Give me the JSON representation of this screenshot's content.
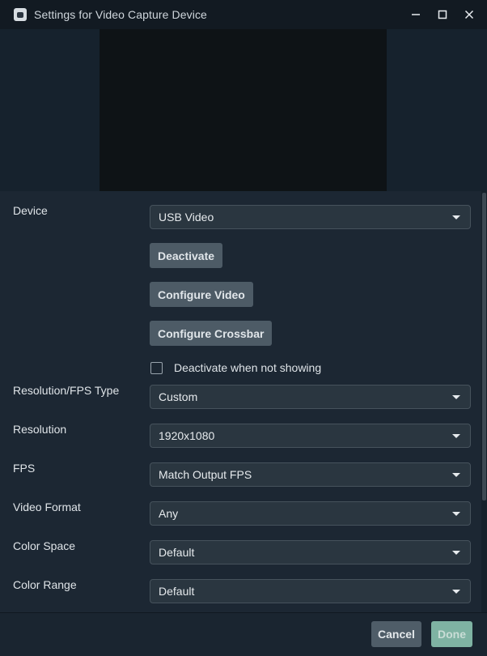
{
  "window": {
    "title": "Settings for Video Capture Device",
    "app_icon": "app-icon",
    "controls": [
      "minimize-icon",
      "maximize-icon",
      "close-icon"
    ]
  },
  "form": {
    "device": {
      "label": "Device",
      "value": "USB Video"
    },
    "buttons": {
      "deactivate": "Deactivate",
      "configure_video": "Configure Video",
      "configure_crossbar": "Configure Crossbar"
    },
    "deactivate_when_not_showing": {
      "label": "Deactivate when not showing",
      "checked": false
    },
    "resolution_fps_type": {
      "label": "Resolution/FPS Type",
      "value": "Custom"
    },
    "resolution": {
      "label": "Resolution",
      "value": "1920x1080"
    },
    "fps": {
      "label": "FPS",
      "value": "Match Output FPS"
    },
    "video_format": {
      "label": "Video Format",
      "value": "Any"
    },
    "color_space": {
      "label": "Color Space",
      "value": "Default"
    },
    "color_range": {
      "label": "Color Range",
      "value": "Default"
    }
  },
  "footer": {
    "cancel_label": "Cancel",
    "done_label": "Done"
  },
  "colors": {
    "background": "#1c2733",
    "titlebar": "#121a22",
    "button": "#4d5b66",
    "done_button": "#7fb3a3"
  }
}
